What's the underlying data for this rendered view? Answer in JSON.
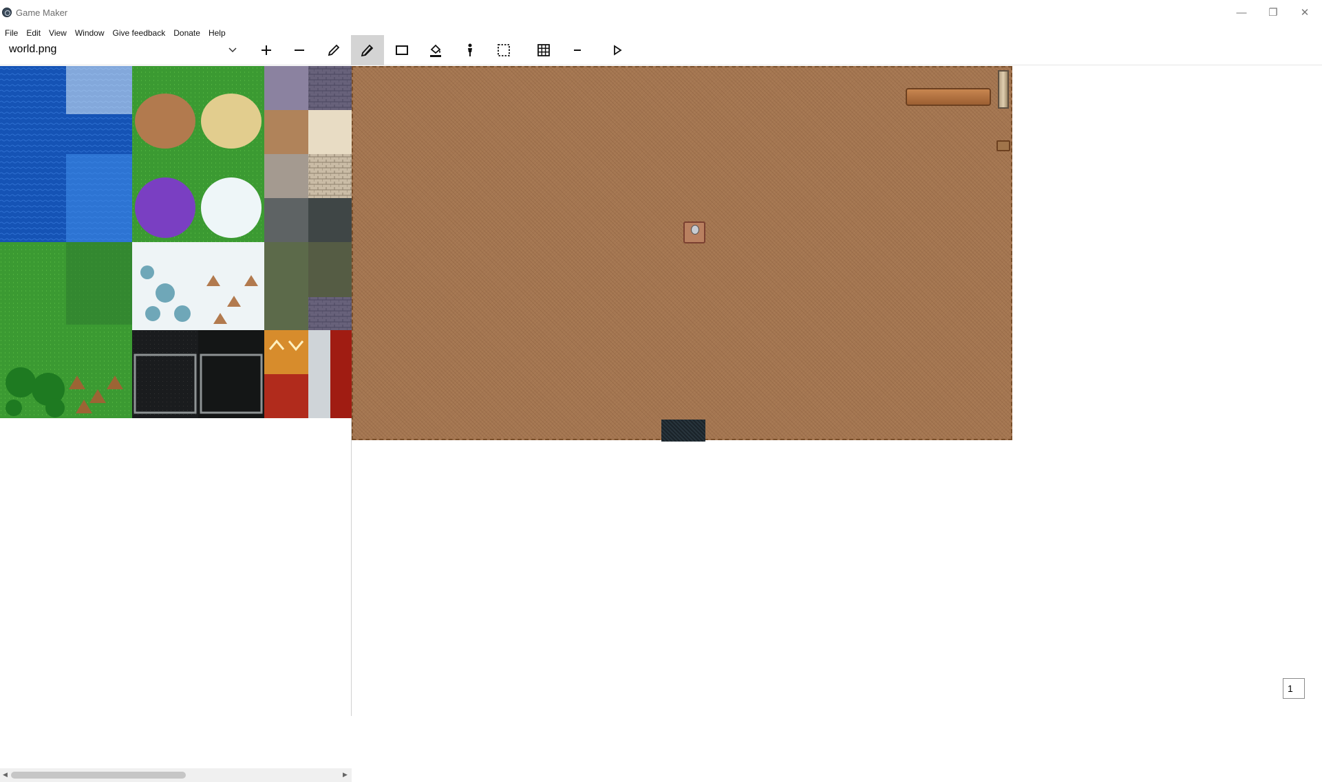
{
  "window": {
    "title": "Game Maker"
  },
  "window_controls": [
    "minimize-icon",
    "restore-icon",
    "close-icon"
  ],
  "menu": [
    "File",
    "Edit",
    "View",
    "Window",
    "Give feedback",
    "Donate",
    "Help"
  ],
  "toolbar": {
    "file_selected": "world.png",
    "tools": [
      {
        "name": "zoom-in",
        "icon": "plus-icon"
      },
      {
        "name": "zoom-out",
        "icon": "minus-icon"
      },
      {
        "name": "pencil",
        "icon": "pencil-icon"
      },
      {
        "name": "brush",
        "icon": "brush-icon",
        "active": true
      },
      {
        "name": "rectangle",
        "icon": "rectangle-icon"
      },
      {
        "name": "fill",
        "icon": "paint-bucket-icon"
      },
      {
        "name": "character",
        "icon": "person-icon"
      },
      {
        "name": "select",
        "icon": "dashed-select-icon"
      },
      {
        "name": "grid",
        "icon": "grid-icon"
      },
      {
        "name": "line",
        "icon": "line-icon"
      },
      {
        "name": "play",
        "icon": "play-icon"
      }
    ]
  },
  "page_number": "1"
}
